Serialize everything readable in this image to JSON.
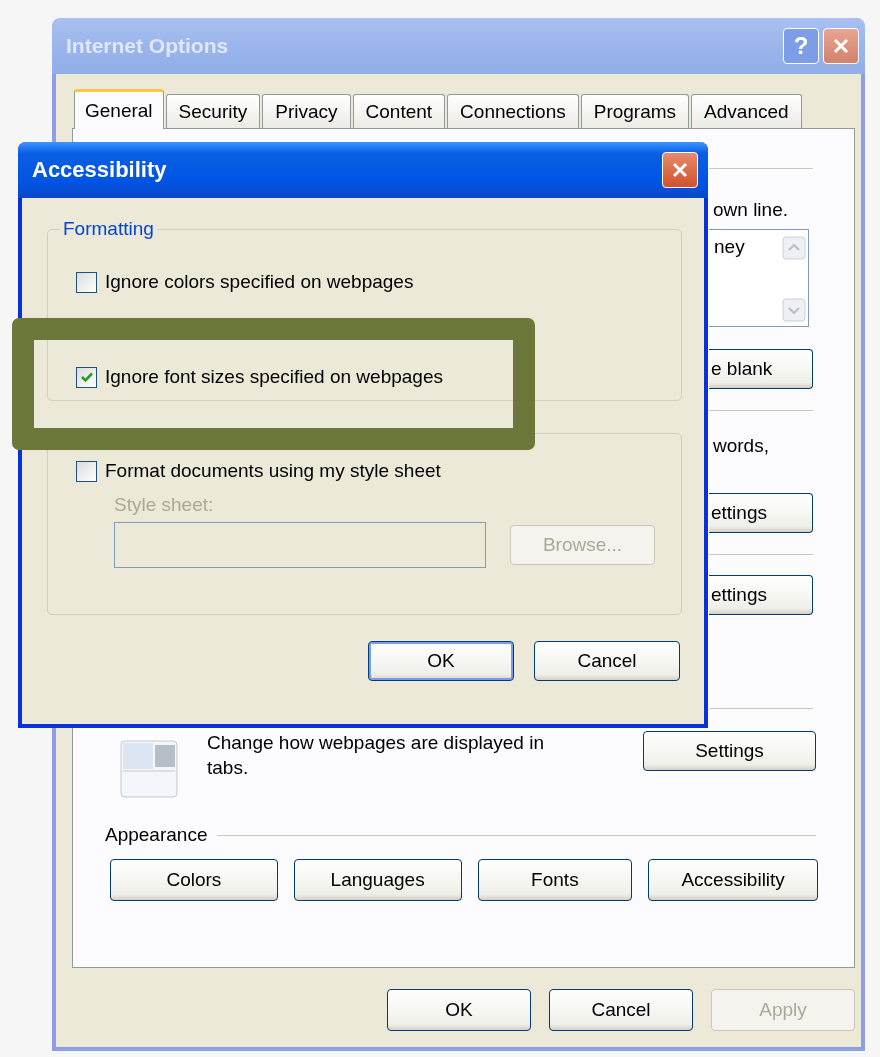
{
  "window": {
    "title": "Internet Options",
    "help_button": "?"
  },
  "tabs": [
    {
      "label": "General",
      "selected": true
    },
    {
      "label": "Security",
      "selected": false
    },
    {
      "label": "Privacy",
      "selected": false
    },
    {
      "label": "Content",
      "selected": false
    },
    {
      "label": "Connections",
      "selected": false
    },
    {
      "label": "Programs",
      "selected": false
    },
    {
      "label": "Advanced",
      "selected": false
    }
  ],
  "general_page": {
    "sections": [
      {
        "items": [
          {
            "kind": "text",
            "text": "own line."
          },
          {
            "kind": "listbox",
            "text": "ney"
          },
          {
            "kind": "button",
            "text": "e blank"
          }
        ]
      },
      {
        "items": [
          {
            "kind": "text",
            "text": "words,"
          },
          {
            "kind": "button",
            "text": "ettings"
          }
        ]
      },
      {
        "items": [
          {
            "kind": "button",
            "text": "ettings"
          }
        ]
      }
    ],
    "tabs_setting": {
      "description": "Change how webpages are displayed in tabs.",
      "button": "Settings"
    },
    "appearance": {
      "heading": "Appearance",
      "buttons": [
        "Colors",
        "Languages",
        "Fonts",
        "Accessibility"
      ]
    }
  },
  "buttons": [
    {
      "label": "OK",
      "disabled": false
    },
    {
      "label": "Cancel",
      "disabled": false
    },
    {
      "label": "Apply",
      "disabled": true
    }
  ],
  "dialog": {
    "title": "Accessibility",
    "formatting": {
      "heading": "Formatting",
      "options": [
        {
          "label": "Ignore colors specified on webpages",
          "checked": false
        },
        {
          "label": "Ignore font sizes specified on webpages",
          "checked": true
        }
      ]
    },
    "style_sheet": {
      "option": {
        "label": "Format documents using my style sheet",
        "checked": false
      },
      "field_label": "Style sheet:",
      "browse": "Browse...",
      "disabled": true
    },
    "buttons": [
      {
        "label": "OK",
        "default": true
      },
      {
        "label": "Cancel",
        "default": false
      }
    ]
  }
}
